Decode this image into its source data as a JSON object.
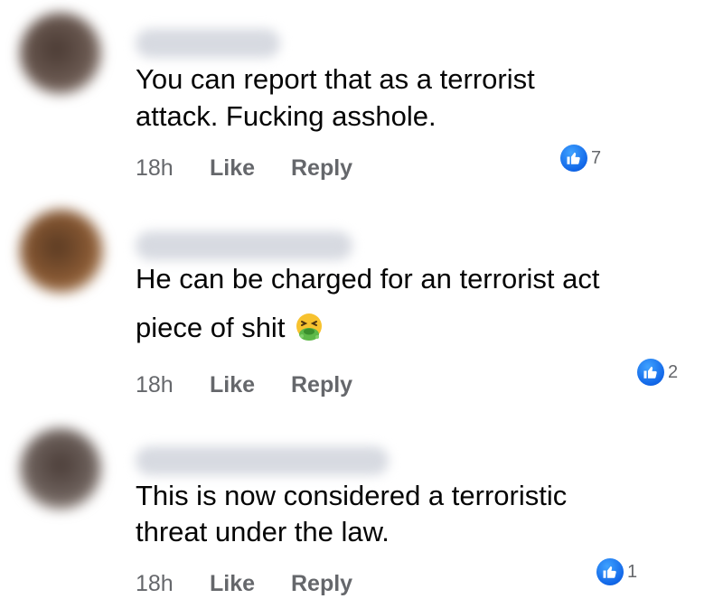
{
  "comments": [
    {
      "text_lines": [
        "You can report that as a terrorist",
        "attack. Fucking asshole."
      ],
      "time": "18h",
      "like_label": "Like",
      "reply_label": "Reply",
      "reaction_count": "7"
    },
    {
      "text_lines": [
        "He can be charged for an terrorist act",
        "piece of shit"
      ],
      "emoji": "nauseated-face-emoji",
      "time": "18h",
      "like_label": "Like",
      "reply_label": "Reply",
      "reaction_count": "2"
    },
    {
      "text_lines": [
        "This is now considered a terroristic",
        "threat under the law."
      ],
      "time": "18h",
      "like_label": "Like",
      "reply_label": "Reply",
      "reaction_count": "1"
    }
  ],
  "colors": {
    "meta_text": "#65676b",
    "body_text": "#050505",
    "like_blue": "#1877f2",
    "name_blur": "#d7dae1"
  }
}
